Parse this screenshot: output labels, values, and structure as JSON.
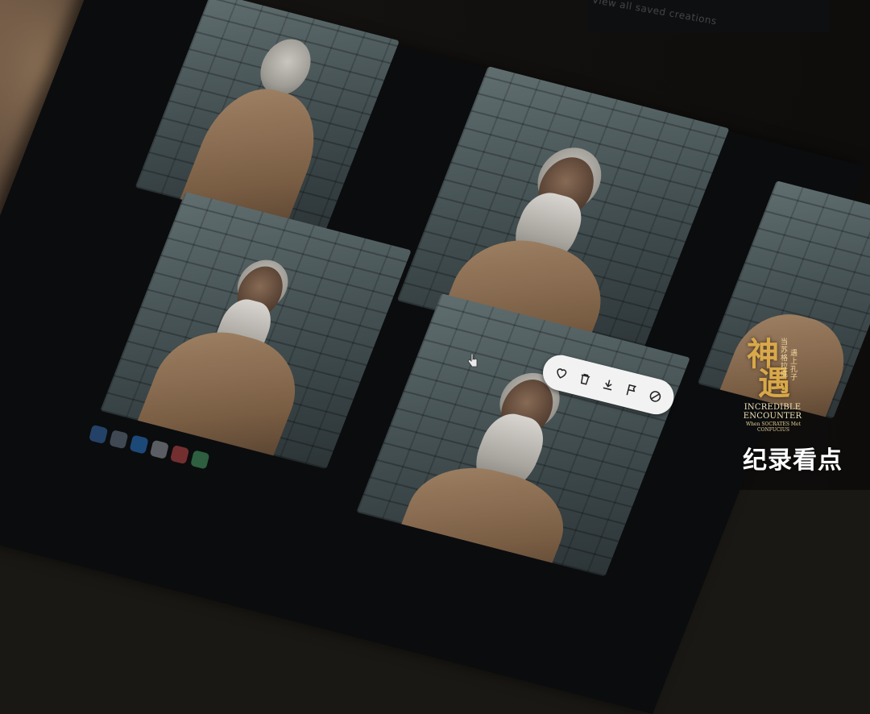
{
  "screen": {
    "top_bar_text": "View all saved creations"
  },
  "watermark": {
    "logo_cn_1": "神",
    "logo_cn_2": "遇",
    "logo_sub_1": "当苏格拉底",
    "logo_sub_2": "遇上孔子",
    "logo_en_1": "INCREDIBLE",
    "logo_en_2": "ENCOUNTER",
    "logo_small": "When SOCRATES Met CONFUCIUS",
    "channel": "纪录看点"
  },
  "toolbar": {
    "icons": [
      "heart-icon",
      "trash-icon",
      "download-icon",
      "flag-icon",
      "slash-icon"
    ]
  },
  "colors": {
    "toolbar_bg": "#f2f2f2",
    "logo_gold": "#d9a84a",
    "channel_text": "#ffffff"
  }
}
